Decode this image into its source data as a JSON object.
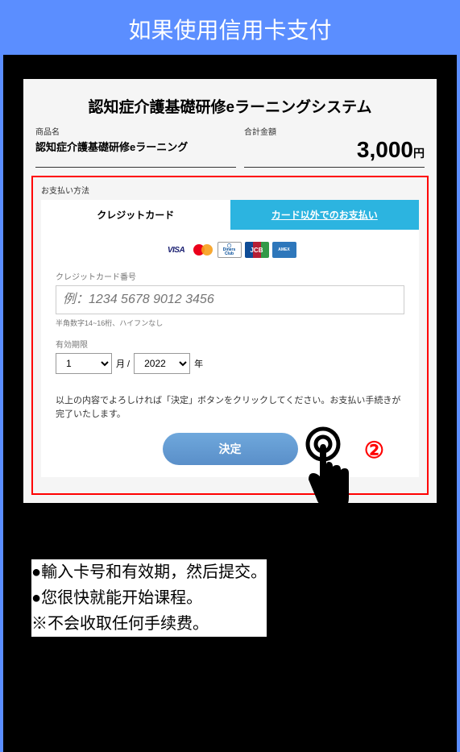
{
  "header": {
    "title": "如果使用信用卡支付"
  },
  "screen": {
    "title": "認知症介護基礎研修eラーニングシステム",
    "product_label": "商品名",
    "product_value": "認知症介護基礎研修eラーニング",
    "total_label": "合計金額",
    "total_value": "3,000",
    "total_unit": "円",
    "payment_method_label": "お支払い方法",
    "tab_credit": "クレジットカード",
    "tab_other": "カード以外でのお支払い",
    "card_number_label": "クレジットカード番号",
    "card_number_placeholder": "例：1234 5678 9012 3456",
    "card_number_hint": "半角数字14~16桁、ハイフンなし",
    "expiry_label": "有効期限",
    "expiry_month": "1",
    "expiry_month_suffix": "月 /",
    "expiry_year": "2022",
    "expiry_year_suffix": "年",
    "confirm_text": "以上の内容でよろしければ「決定」ボタンをクリックしてください。お支払い手続きが完了いたします。",
    "submit_label": "決定",
    "step_number": "②"
  },
  "instructions": {
    "line1": "●輸入卡号和有效期，然后提交。",
    "line2": "●您很快就能开始课程。",
    "line3": "※不会收取任何手续费。"
  }
}
